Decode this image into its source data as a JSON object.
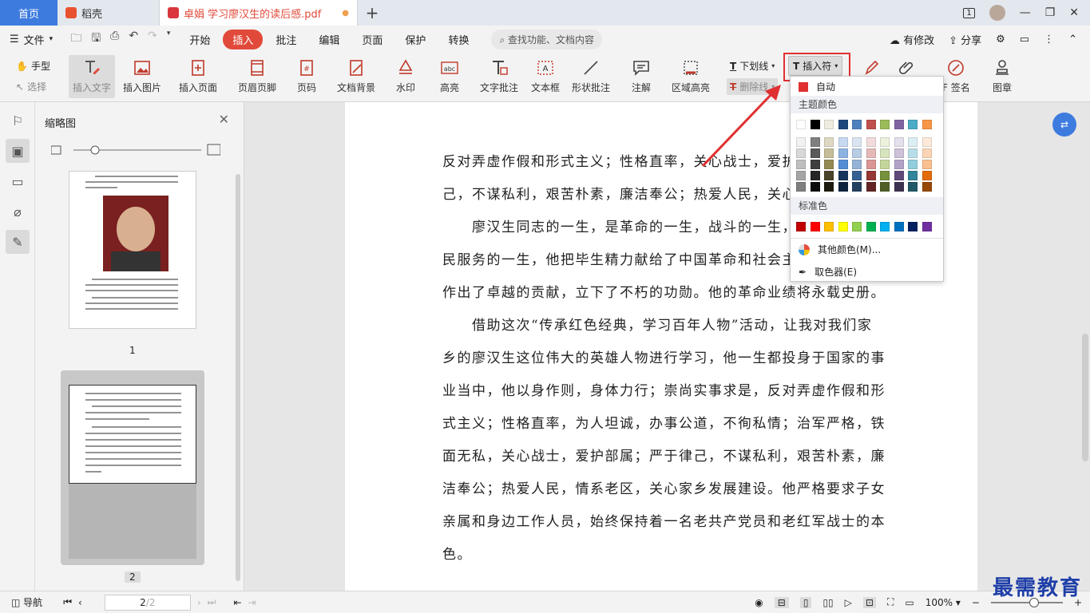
{
  "titlebar": {
    "home_tab": "首页",
    "app_tab": "稻壳",
    "doc_tab": "卓娟 学习廖汉生的读后感.pdf",
    "page_badge": "1"
  },
  "menubar": {
    "file": "文件",
    "tabs": [
      "开始",
      "插入",
      "批注",
      "编辑",
      "页面",
      "保护",
      "转换"
    ],
    "active_tab": "插入",
    "search_placeholder": "查找功能、文档内容",
    "modified": "有修改",
    "share": "分享"
  },
  "ribbon": {
    "hand": "手型",
    "select": "选择",
    "insert_text": "插入文字",
    "insert_image": "插入图片",
    "insert_page": "插入页面",
    "header_footer": "页眉页脚",
    "page_number": "页码",
    "doc_background": "文档背景",
    "watermark": "水印",
    "highlight": "高亮",
    "text_annotation": "文字批注",
    "text_box": "文本框",
    "shape_annotation": "形状批注",
    "annotation": "注解",
    "area_highlight": "区域高亮",
    "underline": "下划线",
    "strikethrough": "删除线",
    "insert_mark": "插入符",
    "signature": "F 签名",
    "stamp": "图章"
  },
  "color_dropdown": {
    "auto_label": "自动",
    "theme_colors_title": "主题颜色",
    "theme_top_row": [
      "#ffffff",
      "#000000",
      "#eeece1",
      "#1f497d",
      "#4f81bd",
      "#c0504d",
      "#9bbb59",
      "#8064a2",
      "#4bacc6",
      "#f79646"
    ],
    "theme_shades": [
      [
        "#f2f2f2",
        "#7f7f7f",
        "#ddd9c3",
        "#c6d9f0",
        "#dbe5f1",
        "#f2dcdb",
        "#ebf1dd",
        "#e5e0ec",
        "#dbeef3",
        "#fdeada"
      ],
      [
        "#d8d8d8",
        "#595959",
        "#c4bd97",
        "#8db3e2",
        "#b8cce4",
        "#e5b9b7",
        "#d7e3bc",
        "#ccc1d9",
        "#b7dde8",
        "#fbd5b5"
      ],
      [
        "#bfbfbf",
        "#3f3f3f",
        "#938953",
        "#548dd4",
        "#95b3d7",
        "#d99694",
        "#c3d69b",
        "#b2a2c7",
        "#92cddc",
        "#fac08f"
      ],
      [
        "#a5a5a5",
        "#262626",
        "#494429",
        "#17365d",
        "#366092",
        "#953734",
        "#76923c",
        "#5f497a",
        "#31859b",
        "#e36c09"
      ],
      [
        "#7f7f7f",
        "#0c0c0c",
        "#1d1b10",
        "#0f243e",
        "#244061",
        "#632423",
        "#4f6128",
        "#3f3151",
        "#205867",
        "#974806"
      ]
    ],
    "standard_colors_title": "标准色",
    "standard_colors": [
      "#c00000",
      "#ff0000",
      "#ffc000",
      "#ffff00",
      "#92d050",
      "#00b050",
      "#00b0f0",
      "#0070c0",
      "#002060",
      "#7030a0"
    ],
    "more_colors": "其他颜色(M)...",
    "eyedropper": "取色器(E)"
  },
  "sidebar": {
    "title": "缩略图",
    "page1_label": "1",
    "page2_label": "2"
  },
  "document": {
    "paragraphs": [
      "反对弄虚作假和形式主义；性格直率，关心战士，爱护部属；严于律己，不谋私利，艰苦朴素，廉洁奉公；热爱人民，关心家乡发展建设。",
      "廖汉生同志的一生，是革命的一生，战斗的一生，是全心全意为人民服务的一生，他把毕生精力献给了中国革命和社会主义建设事业，作出了卓越的贡献，立下了不朽的功勋。他的革命业绩将永载史册。",
      "借助这次“传承红色经典，学习百年人物”活动，让我对我们家乡的廖汉生这位伟大的英雄人物进行学习，他一生都投身于国家的事业当中，他以身作则，身体力行；崇尚实事求是，反对弄虚作假和形式主义；性格直率，为人坦诚，办事公道，不徇私情；治军严格，铁面无私，关心战士，爱护部属；严于律己，不谋私利，艰苦朴素，廉洁奉公；热爱人民，情系老区，关心家乡发展建设。他严格要求子女亲属和身边工作人员，始终保持着一名老共产党员和老红军战士的本色。"
    ],
    "lines": [
      "反对弄虚作假和形式主义；性格直率，关心战士，爱护",
      "己，不谋私利，艰苦朴素，廉洁奉公；热爱人民，关心家",
      "　　廖汉生同志的一生，是革命的一生，战斗的一生，",
      "民服务的一生，他把毕生精力献给了中国革命和社会主",
      "作出了卓越的贡献，立下了不朽的功勋。他的革命业绩将永载史册。",
      "　　借助这次“传承红色经典，学习百年人物”活动，让我对我们家",
      "乡的廖汉生这位伟大的英雄人物进行学习，他一生都投身于国家的事",
      "业当中，他以身作则，身体力行；崇尚实事求是，反对弄虚作假和形",
      "式主义；性格直率，为人坦诚，办事公道，不徇私情；治军严格，铁",
      "面无私，关心战士，爱护部属；严于律己，不谋私利，艰苦朴素，廉",
      "洁奉公；热爱人民，情系老区，关心家乡发展建设。他严格要求子女",
      "亲属和身边工作人员，始终保持着一名老共产党员和老红军战士的本",
      "色。"
    ]
  },
  "statusbar": {
    "nav": "导航",
    "page_current": "2",
    "page_total": "/2",
    "zoom": "100%",
    "zoom_level": 0.6
  },
  "watermark_text": "最需教育",
  "colors": {
    "accent_red": "#e14a3a",
    "accent_blue": "#3d7bdf",
    "highlight_box": "#e03030"
  }
}
